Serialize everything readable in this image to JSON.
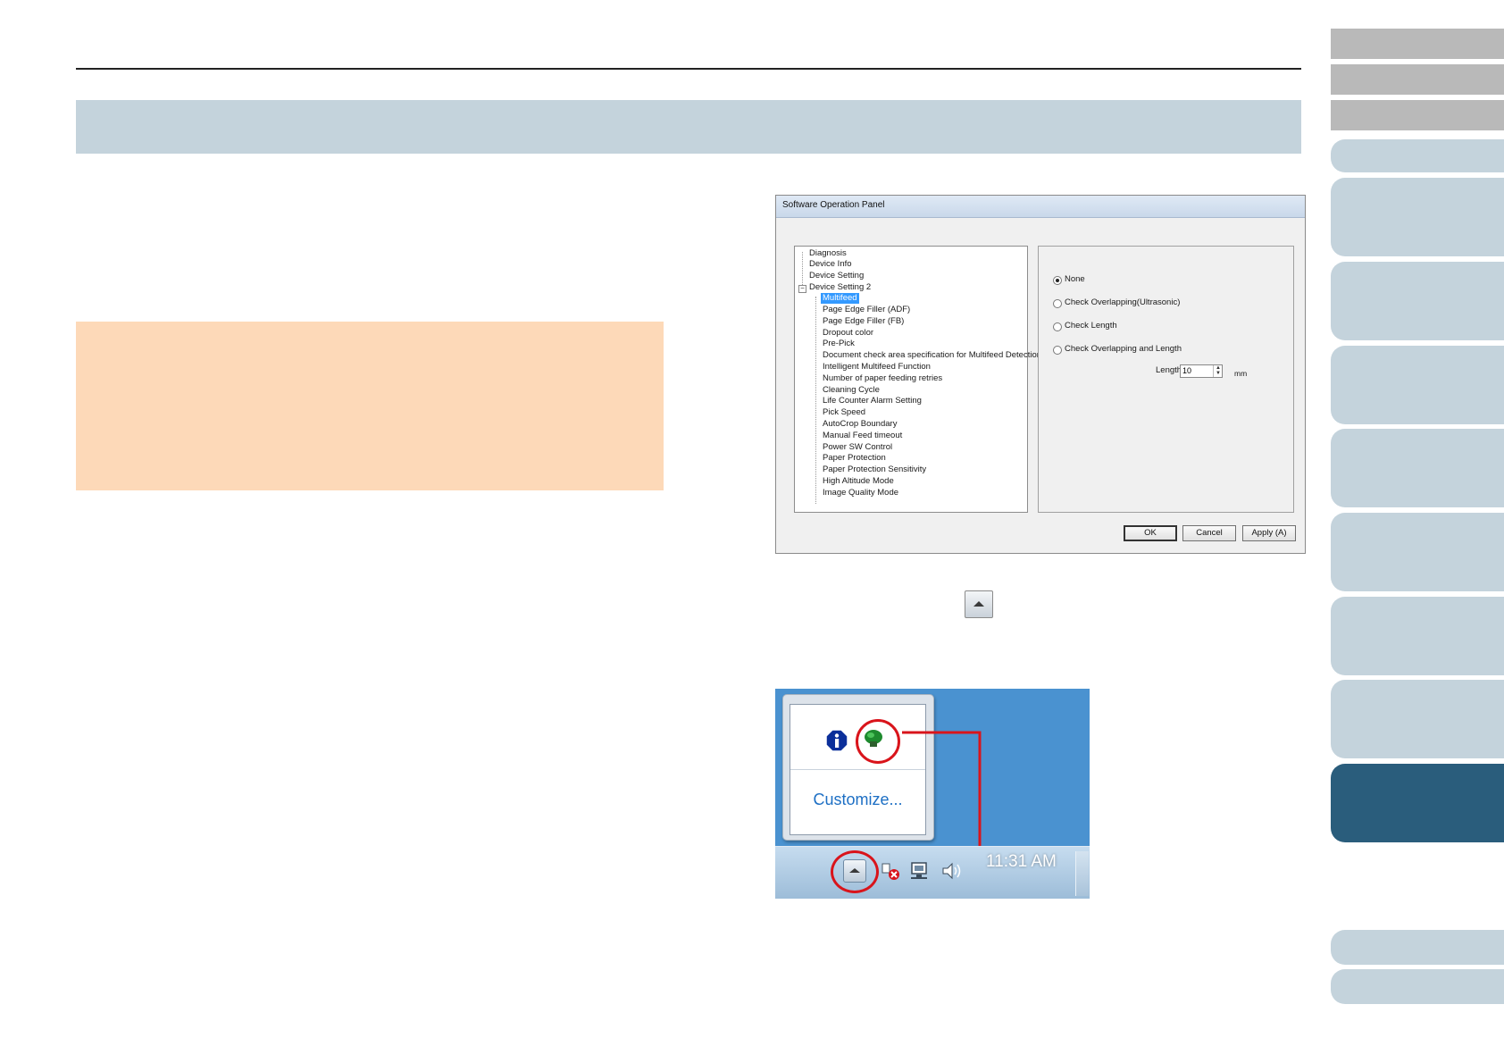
{
  "dialog": {
    "title": "Software Operation Panel",
    "tree_root_items": [
      "Diagnosis",
      "Device Info",
      "Device Setting",
      "Device Setting 2"
    ],
    "tree_child_items": [
      "Multifeed",
      "Page Edge Filler (ADF)",
      "Page Edge Filler (FB)",
      "Dropout color",
      "Pre-Pick",
      "Document check area specification for Multifeed Detection",
      "Intelligent Multifeed Function",
      "Number of paper feeding retries",
      "Cleaning Cycle",
      "Life Counter Alarm Setting",
      "Pick Speed",
      "AutoCrop Boundary",
      "Manual Feed timeout",
      "Power SW Control",
      "Paper Protection",
      "Paper Protection Sensitivity",
      "High Altitude Mode",
      "Image Quality Mode"
    ],
    "selected_item": "Multifeed",
    "options": [
      {
        "label": "None",
        "selected": true
      },
      {
        "label": "Check Overlapping(Ultrasonic)",
        "selected": false
      },
      {
        "label": "Check Length",
        "selected": false
      },
      {
        "label": "Check Overlapping and Length",
        "selected": false
      }
    ],
    "length_label": "Length",
    "length_value": "10",
    "length_unit": "mm",
    "buttons": {
      "ok": "OK",
      "cancel": "Cancel",
      "apply": "Apply (A)"
    }
  },
  "taskbar": {
    "customize_label": "Customize...",
    "clock": "11:31 AM",
    "icons": [
      "info-icon",
      "scanner-icon",
      "network-error-icon",
      "network-icon",
      "speaker-icon"
    ],
    "highlight_color": "#d9141b"
  },
  "colors": {
    "title_band": "#c4d3dc",
    "note_box": "#fdd9b8",
    "tab": "#c4d3dc",
    "tab_active": "#2a5d7c",
    "tab_gray": "#b9b9b9"
  }
}
